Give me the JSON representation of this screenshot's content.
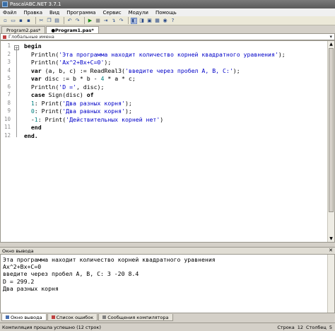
{
  "window": {
    "title": "PascalABC.NET 3.7.1"
  },
  "menu": [
    "Файл",
    "Правка",
    "Вид",
    "Программа",
    "Сервис",
    "Модули",
    "Помощь"
  ],
  "toolbar": {
    "buttons": [
      "new-icon",
      "open-icon",
      "save-icon",
      "save-all-icon",
      "cut-icon",
      "copy-icon",
      "paste-icon",
      "undo-icon",
      "redo-icon",
      "run-icon",
      "stop-icon",
      "step-icon",
      "step-into-icon",
      "step-over-icon",
      "breakpoint-icon",
      "debug-icon",
      "form-icon",
      "layout-icon",
      "watch-icon",
      "help-icon"
    ]
  },
  "tabs": [
    {
      "label": "Program2.pas*",
      "active": false
    },
    {
      "label": "●Program1.pas*",
      "active": true
    }
  ],
  "scope": {
    "label": "Глобальные имена"
  },
  "editor": {
    "line_numbers": [
      "1",
      "2",
      "3",
      "4",
      "5",
      "6",
      "7",
      "8",
      "9",
      "10",
      "11",
      "12"
    ],
    "lines": [
      [
        {
          "t": "begin",
          "c": "kw"
        }
      ],
      [
        {
          "t": "  Println("
        },
        {
          "t": "'Эта программа находит количество корней квадратного уравнения'",
          "c": "str"
        },
        {
          "t": ");"
        }
      ],
      [
        {
          "t": "  Println("
        },
        {
          "t": "'Ax^2+Bx+C=0'",
          "c": "str"
        },
        {
          "t": ");"
        }
      ],
      [
        {
          "t": "  "
        },
        {
          "t": "var",
          "c": "kw"
        },
        {
          "t": " (a, b, c) := ReadReal3("
        },
        {
          "t": "'введите через пробел A, B, C:'",
          "c": "str"
        },
        {
          "t": ");"
        }
      ],
      [
        {
          "t": "  "
        },
        {
          "t": "var",
          "c": "kw"
        },
        {
          "t": " disc := b * b - "
        },
        {
          "t": "4",
          "c": "num"
        },
        {
          "t": " * a * c;"
        }
      ],
      [
        {
          "t": "  Println("
        },
        {
          "t": "'D ='",
          "c": "str"
        },
        {
          "t": ", disc);"
        }
      ],
      [
        {
          "t": "  "
        },
        {
          "t": "case",
          "c": "kw"
        },
        {
          "t": " Sign(disc) "
        },
        {
          "t": "of",
          "c": "kw"
        }
      ],
      [
        {
          "t": "  "
        },
        {
          "t": "1",
          "c": "num"
        },
        {
          "t": ": Print("
        },
        {
          "t": "'Два разных корня'",
          "c": "str"
        },
        {
          "t": ");"
        }
      ],
      [
        {
          "t": "  "
        },
        {
          "t": "0",
          "c": "num"
        },
        {
          "t": ": Print("
        },
        {
          "t": "'Два равных корня'",
          "c": "str"
        },
        {
          "t": ");"
        }
      ],
      [
        {
          "t": "  -"
        },
        {
          "t": "1",
          "c": "num"
        },
        {
          "t": ": Print("
        },
        {
          "t": "'Действительных корней нет'",
          "c": "str"
        },
        {
          "t": ")"
        }
      ],
      [
        {
          "t": "  "
        },
        {
          "t": "end",
          "c": "kw"
        }
      ],
      [
        {
          "t": "end.",
          "c": "kw"
        }
      ]
    ]
  },
  "output_panel": {
    "header": "Окно вывода",
    "lines": [
      "Эта программа находит количество корней квадратного уравнения",
      "Ax^2+Bx+C=0",
      "введите через пробел A, B, C: 3 -20 8.4",
      "D = 299.2",
      "Два разных корня"
    ]
  },
  "bottom_tabs": [
    "Окно вывода",
    "Список ошибок",
    "Сообщения компилятора"
  ],
  "status": {
    "message": "Компиляция прошла успешно (12 строк)",
    "row_label": "Строка",
    "row": "12",
    "col_label": "Столбец",
    "col": "5"
  }
}
